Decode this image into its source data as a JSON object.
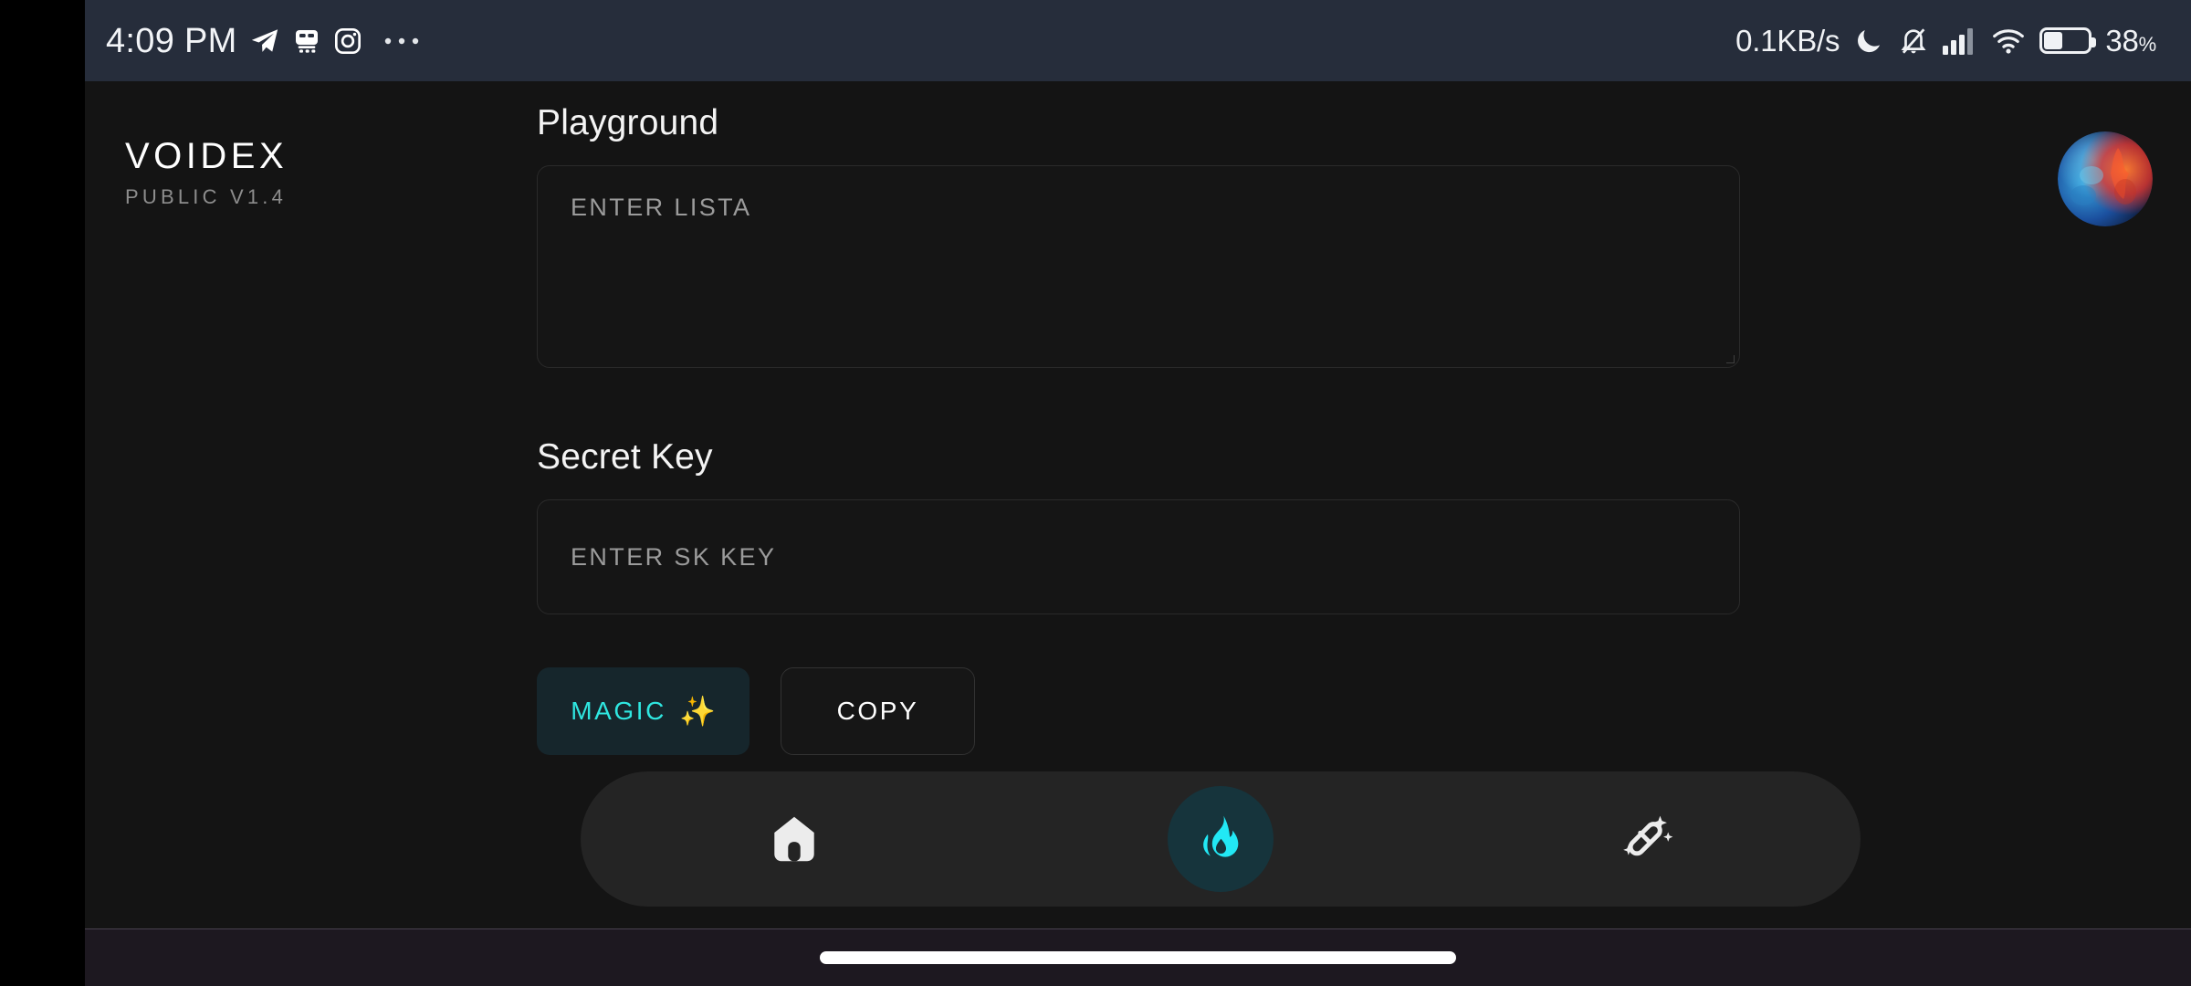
{
  "status_bar": {
    "time": "4:09 PM",
    "icons_left": [
      "telegram-icon",
      "app-icon",
      "instagram-icon",
      "more-dots-icon"
    ],
    "network_speed": "0.1KB/s",
    "icons_right": [
      "moon-icon",
      "bell-off-icon",
      "signal-icon",
      "wifi-icon",
      "battery-icon"
    ],
    "battery_percent": "38",
    "battery_unit": "%",
    "battery_level": 38,
    "bg_color": "#262d3b"
  },
  "brand": {
    "name": "VOIDEX",
    "version": "PUBLIC V1.4"
  },
  "avatar": {
    "name": "user-avatar",
    "alt": "abstract blue and orange smoke profile picture"
  },
  "main": {
    "playground": {
      "title": "Playground",
      "input_placeholder": "ENTER LISTA",
      "input_value": ""
    },
    "secret_key": {
      "title": "Secret Key",
      "input_placeholder": "ENTER SK KEY",
      "input_value": ""
    },
    "actions": {
      "magic_label": "MAGIC",
      "magic_icon": "sparkles-emoji",
      "magic_sparkle": "✨",
      "copy_label": "COPY"
    }
  },
  "bottom_nav": {
    "items": [
      {
        "name": "home",
        "icon": "home-icon",
        "active": false
      },
      {
        "name": "flame",
        "icon": "flame-icon",
        "active": true
      },
      {
        "name": "magic-wand",
        "icon": "magic-wand-icon",
        "active": false
      }
    ],
    "active_index": 1
  },
  "colors": {
    "accent_cyan": "#2fe6e0",
    "flame_cyan": "#22e8f5",
    "sparkle_yellow": "#f7d34e",
    "page_bg": "#141414",
    "statusbar_bg": "#262d3b",
    "nav_bg": "#242424",
    "active_pill_bg": "#16343c"
  },
  "gesture_bar": {
    "name": "home-indicator"
  }
}
